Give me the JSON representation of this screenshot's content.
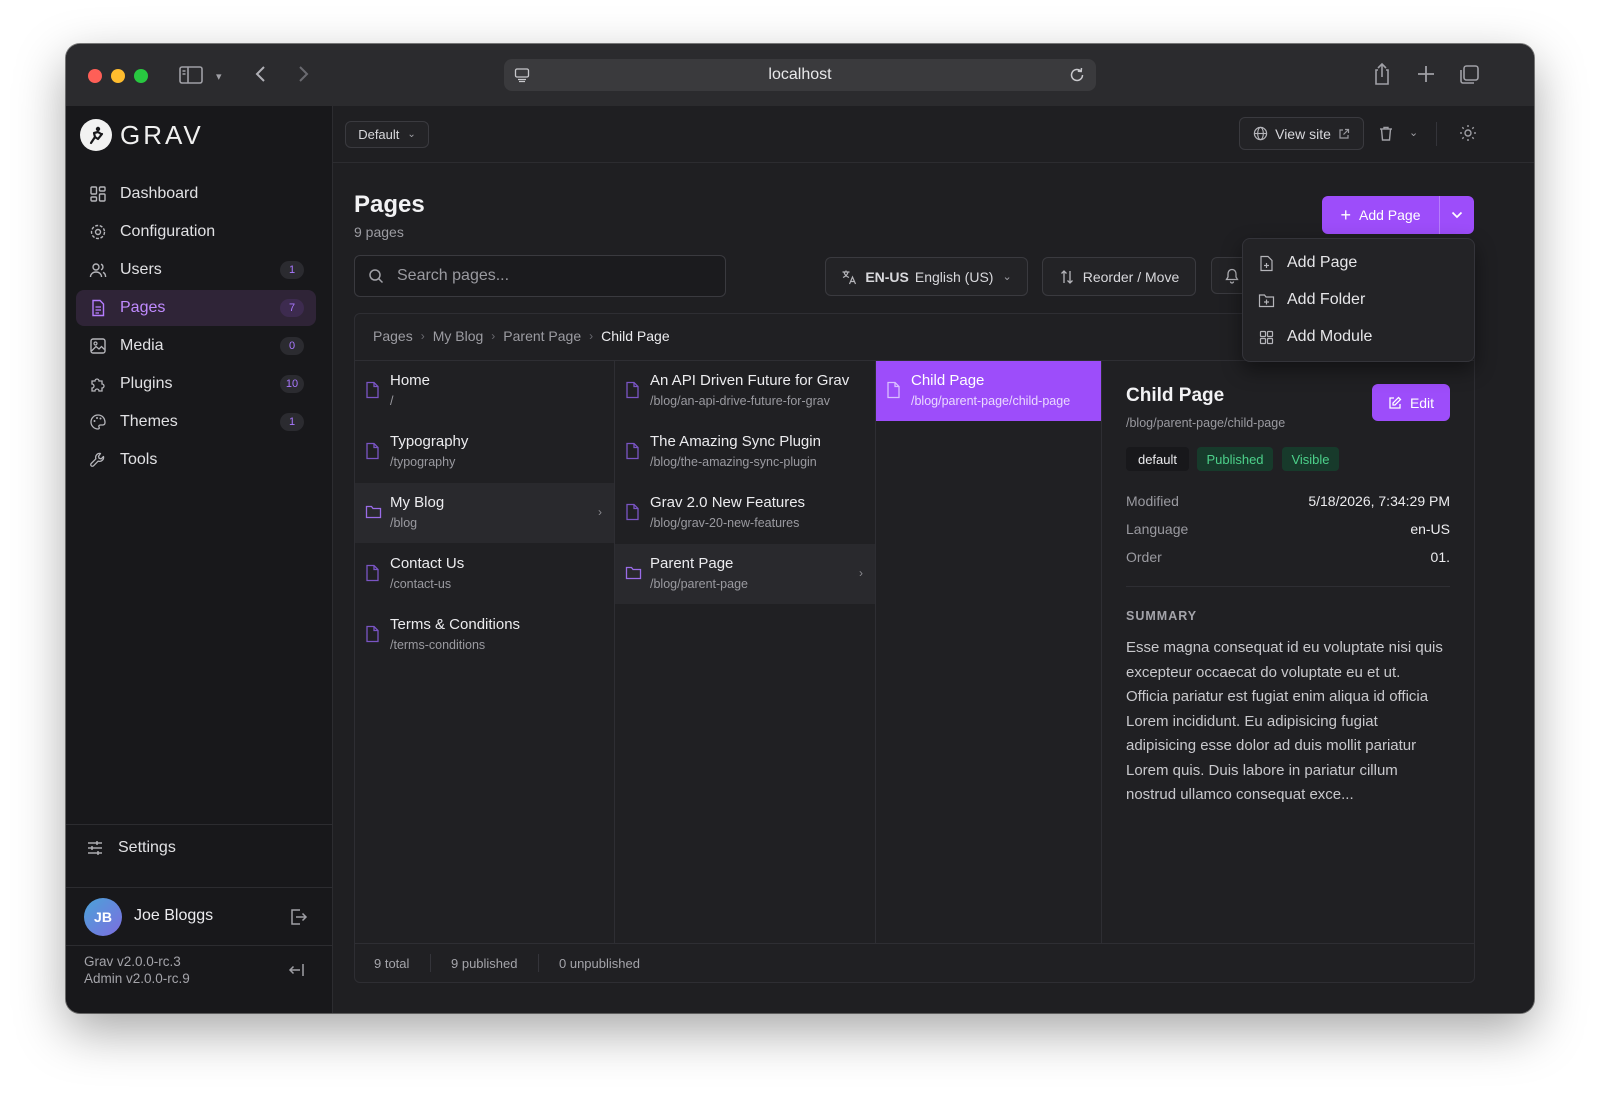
{
  "browser": {
    "url": "localhost"
  },
  "sidebar": {
    "brand": "GRAV",
    "items": [
      {
        "label": "Dashboard",
        "icon": "dashboard-icon",
        "badge": ""
      },
      {
        "label": "Configuration",
        "icon": "gear-icon",
        "badge": ""
      },
      {
        "label": "Users",
        "icon": "users-icon",
        "badge": "1"
      },
      {
        "label": "Pages",
        "icon": "pages-icon",
        "badge": "7"
      },
      {
        "label": "Media",
        "icon": "image-icon",
        "badge": "0"
      },
      {
        "label": "Plugins",
        "icon": "puzzle-icon",
        "badge": "10"
      },
      {
        "label": "Themes",
        "icon": "palette-icon",
        "badge": "1"
      },
      {
        "label": "Tools",
        "icon": "wrench-icon",
        "badge": ""
      }
    ],
    "settings_label": "Settings",
    "user": {
      "initials": "JB",
      "name": "Joe Bloggs"
    },
    "version_grav": "Grav v2.0.0-rc.3",
    "version_admin": "Admin v2.0.0-rc.9"
  },
  "topbar": {
    "environment": "Default",
    "view_site_label": "View site"
  },
  "page": {
    "title": "Pages",
    "subtitle": "9 pages",
    "search_placeholder": "Search pages...",
    "language_code": "EN-US",
    "language_name": "English (US)",
    "reorder_label": "Reorder / Move",
    "add_page_label": "Add Page"
  },
  "add_menu": {
    "items": [
      {
        "label": "Add Page",
        "icon": "file-plus-icon"
      },
      {
        "label": "Add Folder",
        "icon": "folder-plus-icon"
      },
      {
        "label": "Add Module",
        "icon": "grid-icon"
      }
    ]
  },
  "breadcrumb": [
    "Pages",
    "My Blog",
    "Parent Page",
    "Child Page"
  ],
  "columns": [
    [
      {
        "title": "Home",
        "slug": "/",
        "type": "page"
      },
      {
        "title": "Typography",
        "slug": "/typography",
        "type": "page"
      },
      {
        "title": "My Blog",
        "slug": "/blog",
        "type": "folder",
        "selected": true
      },
      {
        "title": "Contact Us",
        "slug": "/contact-us",
        "type": "page"
      },
      {
        "title": "Terms & Conditions",
        "slug": "/terms-conditions",
        "type": "page"
      }
    ],
    [
      {
        "title": "An API Driven Future for Grav",
        "slug": "/blog/an-api-drive-future-for-grav",
        "type": "page"
      },
      {
        "title": "The Amazing Sync Plugin",
        "slug": "/blog/the-amazing-sync-plugin",
        "type": "page"
      },
      {
        "title": "Grav 2.0 New Features",
        "slug": "/blog/grav-20-new-features",
        "type": "page"
      },
      {
        "title": "Parent Page",
        "slug": "/blog/parent-page",
        "type": "folder",
        "selected": true
      }
    ],
    [
      {
        "title": "Child Page",
        "slug": "/blog/parent-page/child-page",
        "type": "page",
        "active": true
      }
    ]
  ],
  "detail": {
    "title": "Child Page",
    "slug": "/blog/parent-page/child-page",
    "edit_label": "Edit",
    "tags": [
      "default",
      "Published",
      "Visible"
    ],
    "modified_label": "Modified",
    "modified_value": "5/18/2026, 7:34:29 PM",
    "language_label": "Language",
    "language_value": "en-US",
    "order_label": "Order",
    "order_value": "01.",
    "summary_heading": "SUMMARY",
    "summary_lines": [
      "Esse magna consequat id eu voluptate nisi quis",
      "excepteur occaecat do voluptate eu et ut.",
      "Officia pariatur est fugiat enim aliqua id officia",
      "Lorem incididunt. Eu adipisicing fugiat",
      "adipisicing esse dolor ad duis mollit pariatur",
      "Lorem quis. Duis labore in pariatur cillum",
      "nostrud ullamco consequat exce..."
    ]
  },
  "footer": {
    "total": "9 total",
    "published": "9 published",
    "unpublished": "0 unpublished"
  },
  "colors": {
    "accent": "#9d4dfa",
    "published_bg": "#173a2b",
    "published_fg": "#4cd08a"
  }
}
